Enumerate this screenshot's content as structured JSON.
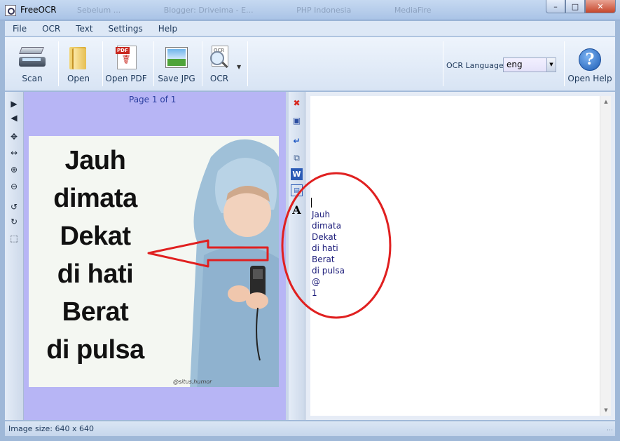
{
  "window": {
    "title": "FreeOCR",
    "background_tabs": [
      "Sebelum ...",
      "Blogger: Driveima - E...",
      "PHP Indonesia",
      "MediaFire"
    ],
    "controls": {
      "minimize": "–",
      "maximize": "□",
      "close": "✕"
    }
  },
  "menu": [
    "File",
    "OCR",
    "Text",
    "Settings",
    "Help"
  ],
  "toolbar": {
    "scan_label": "Scan",
    "open_label": "Open",
    "open_pdf_label": "Open PDF",
    "pdf_badge": "PDF",
    "save_jpg_label": "Save JPG",
    "ocr_label": "OCR",
    "ocr_icon_text": "OCR",
    "ocr_language_label": "OCR Language:",
    "ocr_language_value": "eng",
    "help_label": "Open Help"
  },
  "left_panel": {
    "page_indicator": "Page 1 of 1",
    "image_text_lines": [
      "Jauh",
      "dimata",
      "Dekat",
      "di hati",
      "Berat",
      "di pulsa"
    ],
    "watermark": "@situs.humor",
    "tools": [
      "next-page-icon",
      "prev-page-icon",
      "pan-icon",
      "fit-width-icon",
      "zoom-in-icon",
      "zoom-out-icon",
      "rotate-left-icon",
      "rotate-right-icon",
      "select-area-icon"
    ]
  },
  "right_panel": {
    "tools": [
      "clear-icon",
      "save-icon",
      "return-icon",
      "copy-icon",
      "word-icon",
      "rtf-icon",
      "font-icon"
    ],
    "ocr_output": [
      "Jauh",
      "dimata",
      "Dekat",
      "di hati",
      "Berat",
      "di pulsa",
      "@",
      "1"
    ]
  },
  "status": {
    "image_size": "Image size:  640 x 640"
  },
  "colors": {
    "annotation": "#e02020",
    "canvas": "#b7b5f5",
    "accent": "#1e395b"
  }
}
